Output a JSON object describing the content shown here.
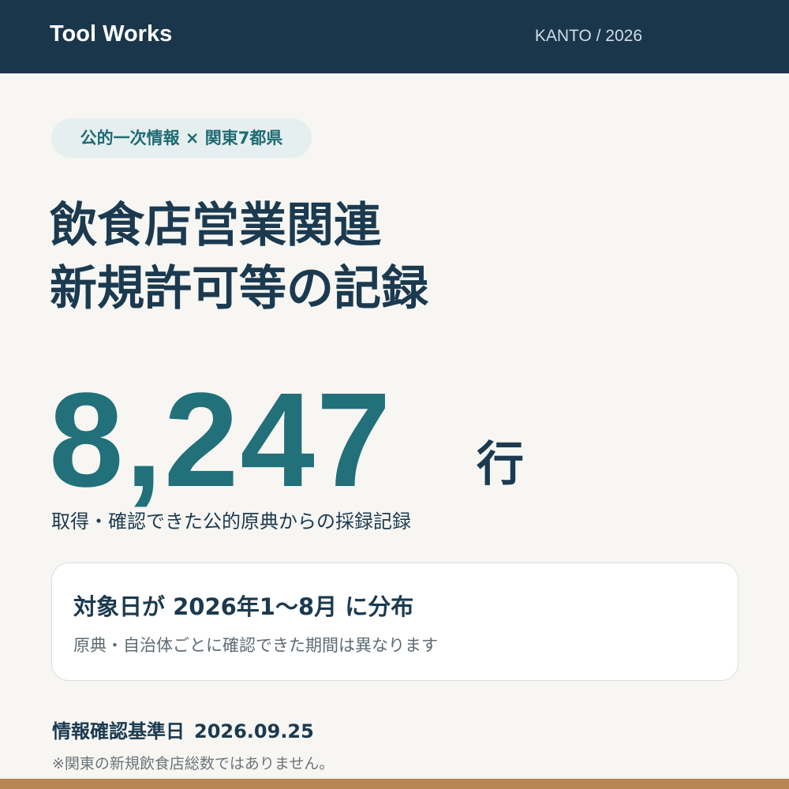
{
  "header": {
    "brand": "Tool Works",
    "region": "KANTO / 2026"
  },
  "tag": "公的一次情報 × 関東7都県",
  "title": {
    "line1": "飲食店営業関連",
    "line2": "新規許可等の記録"
  },
  "count": {
    "value": "8,247",
    "unit": "行",
    "description": "取得・確認できた公的原典からの採録記録"
  },
  "card": {
    "title": "対象日が 2026年1〜8月 に分布",
    "note": "原典・自治体ごとに確認できた期間は異なります"
  },
  "footer": {
    "date_label": "情報確認基準日",
    "date_value": "2026.09.25",
    "disclaimer": "※関東の新規飲食店総数ではありません。"
  },
  "colors": {
    "header_bg": "#1a364b",
    "accent": "#21707a",
    "bottom_bar": "#b98553"
  }
}
